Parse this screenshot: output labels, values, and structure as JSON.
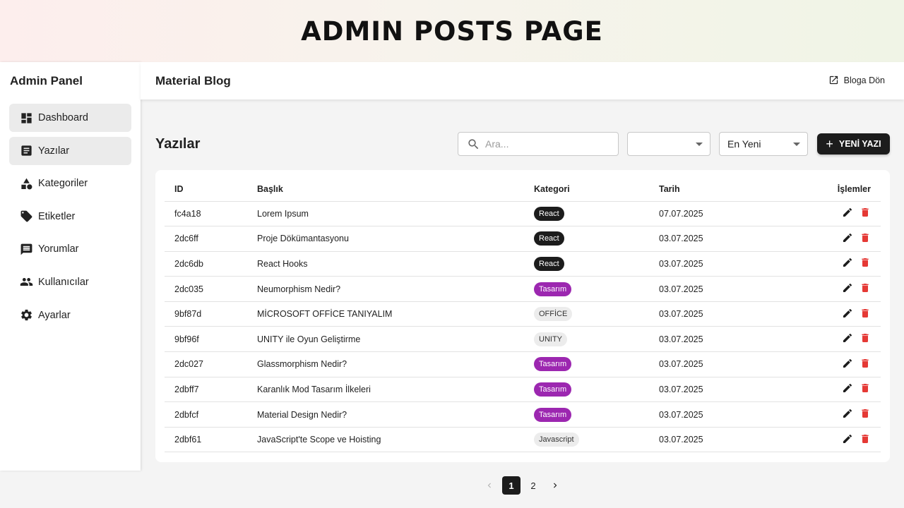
{
  "banner": {
    "title": "ADMIN POSTS PAGE"
  },
  "sidebar": {
    "title": "Admin Panel",
    "items": [
      {
        "label": "Dashboard",
        "icon": "dashboard-icon",
        "active": true
      },
      {
        "label": "Yazılar",
        "icon": "article-icon",
        "active": true
      },
      {
        "label": "Kategoriler",
        "icon": "category-icon",
        "active": false
      },
      {
        "label": "Etiketler",
        "icon": "tag-icon",
        "active": false
      },
      {
        "label": "Yorumlar",
        "icon": "comment-icon",
        "active": false
      },
      {
        "label": "Kullanıcılar",
        "icon": "people-icon",
        "active": false
      },
      {
        "label": "Ayarlar",
        "icon": "gear-icon",
        "active": false
      }
    ]
  },
  "topbar": {
    "title": "Material Blog",
    "back_label": "Bloga Dön"
  },
  "main": {
    "heading": "Yazılar",
    "search_placeholder": "Ara...",
    "category_value": "",
    "sort_value": "En Yeni",
    "new_button_label": "YENİ YAZI"
  },
  "table": {
    "headers": {
      "id": "ID",
      "title": "Başlık",
      "category": "Kategori",
      "date": "Tarih",
      "actions": "İşlemler"
    },
    "rows": [
      {
        "id": "fc4a18",
        "title": "Lorem Ipsum",
        "category": "React",
        "date": "07.07.2025"
      },
      {
        "id": "2dc6ff",
        "title": "Proje Dökümantasyonu",
        "category": "React",
        "date": "03.07.2025"
      },
      {
        "id": "2dc6db",
        "title": "React Hooks",
        "category": "React",
        "date": "03.07.2025"
      },
      {
        "id": "2dc035",
        "title": "Neumorphism Nedir?",
        "category": "Tasarım",
        "date": "03.07.2025"
      },
      {
        "id": "9bf87d",
        "title": "MİCROSOFT OFFİCE TANIYALIM",
        "category": "OFFİCE",
        "date": "03.07.2025"
      },
      {
        "id": "9bf96f",
        "title": "UNITY ile Oyun Geliştirme",
        "category": "UNITY",
        "date": "03.07.2025"
      },
      {
        "id": "2dc027",
        "title": "Glassmorphism Nedir?",
        "category": "Tasarım",
        "date": "03.07.2025"
      },
      {
        "id": "2dbff7",
        "title": "Karanlık Mod Tasarım İlkeleri",
        "category": "Tasarım",
        "date": "03.07.2025"
      },
      {
        "id": "2dbfcf",
        "title": "Material Design Nedir?",
        "category": "Tasarım",
        "date": "03.07.2025"
      },
      {
        "id": "2dbf61",
        "title": "JavaScript'te Scope ve Hoisting",
        "category": "Javascript",
        "date": "03.07.2025"
      }
    ]
  },
  "pagination": {
    "pages": [
      "1",
      "2"
    ],
    "current": "1"
  },
  "colors": {
    "accent_dark": "#1c1c1c",
    "chip_purple": "#9c27b0",
    "chip_grey": "#ececec",
    "delete_red": "#e53935"
  }
}
